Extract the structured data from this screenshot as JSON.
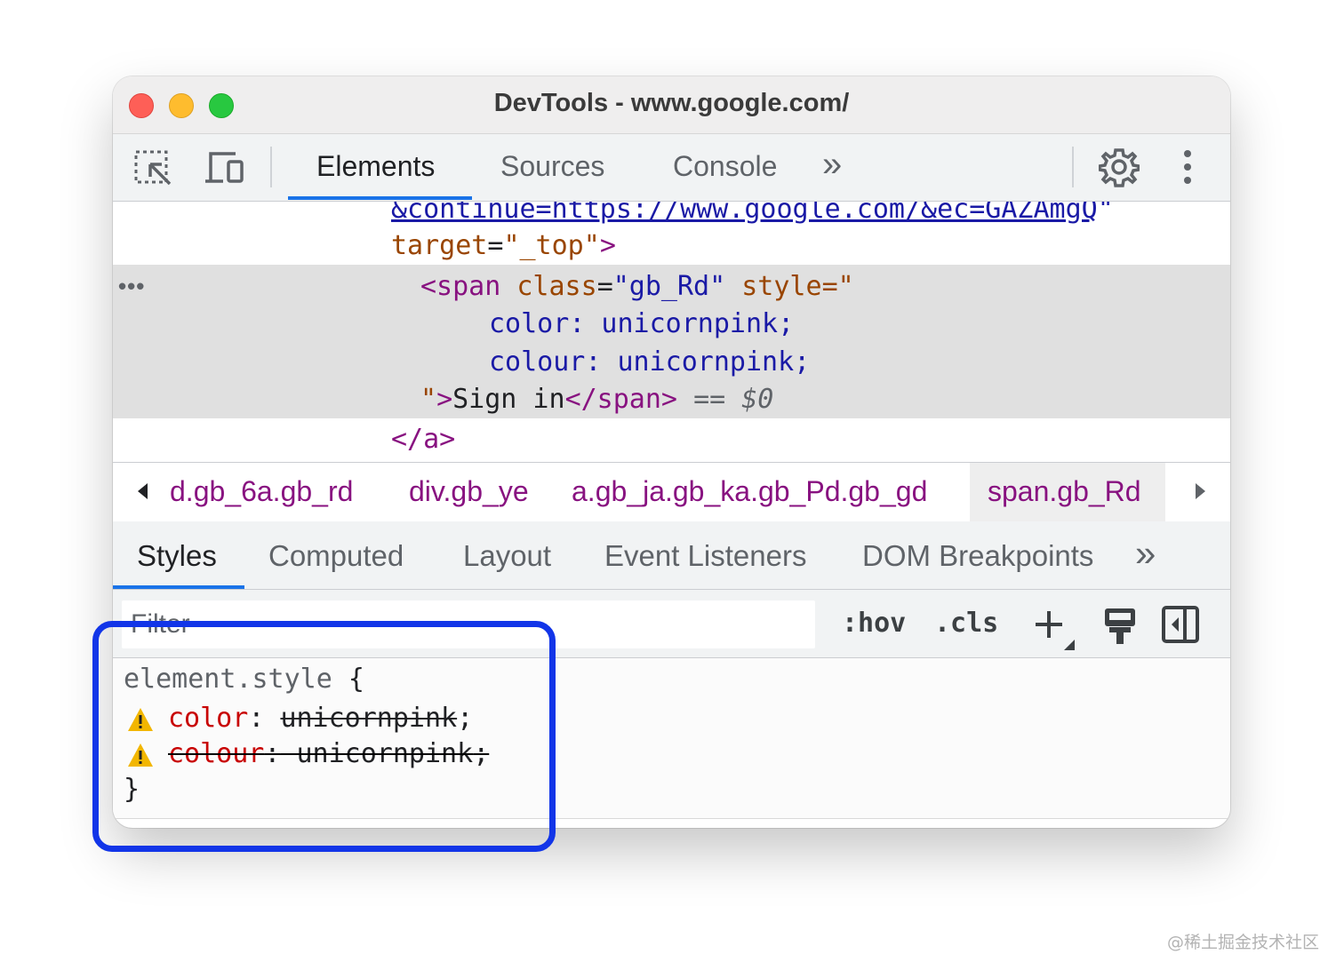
{
  "window": {
    "title": "DevTools - www.google.com/"
  },
  "toolbar": {
    "inspect_icon": "inspect-element-icon",
    "device_icon": "device-toolbar-icon",
    "tabs": [
      {
        "label": "Elements",
        "active": true
      },
      {
        "label": "Sources",
        "active": false
      },
      {
        "label": "Console",
        "active": false
      }
    ],
    "more_tabs": "»",
    "settings_icon": "gear-icon",
    "menu_icon": "kebab-menu-icon"
  },
  "dom": {
    "line1_link": "&continue=https://www.google.com/&ec=GAZAmgQ",
    "line1_quote": "\"",
    "line2_attr": "target",
    "line2_eq": "=",
    "line2_val": "\"_top\"",
    "line2_close": ">",
    "line3_open": "<span",
    "line3_attr1": "class",
    "line3_eq": "=",
    "line3_val1": "\"gb_Rd\"",
    "line3_attr2": "style",
    "line3_val2_start": "=\"",
    "line4": "color: unicornpink;",
    "line5": "colour: unicornpink;",
    "line6_quote": "\"",
    "line6_gt": ">",
    "line6_text": "Sign in",
    "line6_close": "</span>",
    "line6_eq": "==",
    "line6_dollar": "$0",
    "line7": "</a>",
    "ellipsis": "•••"
  },
  "breadcrumbs": {
    "items": [
      "d.gb_6a.gb_rd",
      "div.gb_ye",
      "a.gb_ja.gb_ka.gb_Pd.gb_gd",
      "span.gb_Rd"
    ],
    "selected_index": 3
  },
  "subtabs": {
    "items": [
      {
        "label": "Styles",
        "active": true
      },
      {
        "label": "Computed",
        "active": false
      },
      {
        "label": "Layout",
        "active": false
      },
      {
        "label": "Event Listeners",
        "active": false
      },
      {
        "label": "DOM Breakpoints",
        "active": false
      }
    ],
    "more": "»"
  },
  "filter": {
    "placeholder": "Filter",
    "hov_label": ":hov",
    "cls_label": ".cls",
    "add_rule_icon": "plus-icon",
    "paint_icon": "paint-roller-icon",
    "sidebar_icon": "toggle-sidebar-icon"
  },
  "styles": {
    "selector": "element.style",
    "open_brace": "{",
    "close_brace": "}",
    "declarations": [
      {
        "prop": "color",
        "colon": ":",
        "value": "unicornpink",
        "semicolon": ";",
        "prop_struck": false,
        "value_struck": true,
        "warning": true
      },
      {
        "prop": "colour",
        "colon": ":",
        "value": "unicornpink",
        "semicolon": ";",
        "prop_struck": true,
        "value_struck": true,
        "warning": true
      }
    ]
  },
  "watermark": "@稀土掘金技术社区",
  "colors": {
    "accent": "#1a73e8",
    "highlight_box": "#1235e8",
    "tag": "#881280",
    "attr": "#994500",
    "value": "#1a1aa6",
    "prop": "#c80000",
    "warning": "#f2b600"
  }
}
